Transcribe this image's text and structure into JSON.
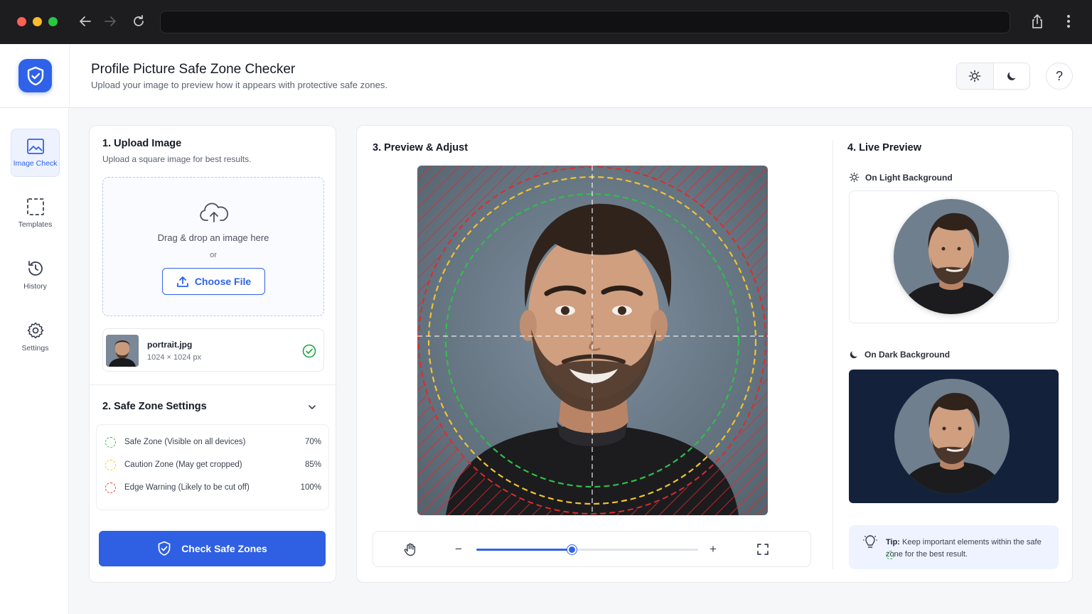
{
  "browser": {
    "colors": {
      "close": "#fe5f57",
      "minimize": "#febc2e",
      "maximize": "#28c840"
    }
  },
  "header": {
    "title": "Profile Picture Safe Zone Checker",
    "subtitle": "Upload your image to preview how it appears with protective safe zones.",
    "help_label": "?"
  },
  "sidebar": {
    "items": [
      {
        "label": "Image Check",
        "icon": "image-icon",
        "active": true
      },
      {
        "label": "Templates",
        "icon": "crop-frame-icon",
        "active": false
      },
      {
        "label": "History",
        "icon": "history-icon",
        "active": false
      },
      {
        "label": "Settings",
        "icon": "gear-icon",
        "active": false
      }
    ]
  },
  "upload": {
    "title": "1. Upload Image",
    "hint": "Upload a square image for best results.",
    "drop_text": "Drag & drop an image here",
    "or_text": "or",
    "choose_label": "Choose File",
    "file": {
      "name": "portrait.jpg",
      "dims": "1024 × 1024 px",
      "status": "uploaded"
    }
  },
  "safe_zone": {
    "title": "2. Safe Zone Settings",
    "zones": [
      {
        "label": "Safe Zone (Visible on all devices)",
        "value": "70%",
        "color": "#2fbf4a"
      },
      {
        "label": "Caution Zone (May get cropped)",
        "value": "85%",
        "color": "#f2c230"
      },
      {
        "label": "Edge Warning (Likely to be cut off)",
        "value": "100%",
        "color": "#e23b3b"
      }
    ],
    "check_label": "Check Safe Zones"
  },
  "preview": {
    "title": "3. Preview & Adjust",
    "zoom": 0.43,
    "minus_label": "−",
    "plus_label": "+"
  },
  "live": {
    "title": "4. Live Preview",
    "light_label": "On Light Background",
    "dark_label": "On Dark Background",
    "tip_bold": "Tip:",
    "tip_text": "Keep important elements within the safe zone for the best result."
  },
  "colors": {
    "accent": "#2f62e8",
    "dark_bg": "#14213a"
  }
}
